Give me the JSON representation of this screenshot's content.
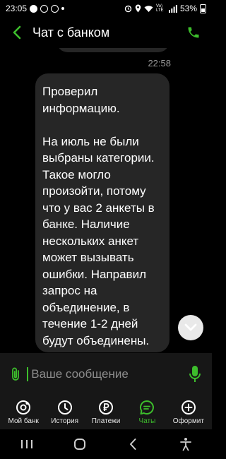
{
  "colors": {
    "accent": "#3dbe2c",
    "bubble": "#262626",
    "panel": "#171717",
    "background": "#000000"
  },
  "status_bar": {
    "time": "23:05",
    "network": "Vo) LTE",
    "battery": "53%"
  },
  "header": {
    "title": "Чат с банком",
    "back_icon": "chevron-left-icon",
    "call_icon": "phone-icon"
  },
  "messages": [
    {
      "time": "22:58",
      "paragraphs": [
        "Проверил информацию.",
        "На июль не были выбраны категории. Такое могло произойти, потому что у вас 2 анкеты в банке. Наличие нескольких анкет может вызывать ошибки. Направил запрос на объединение, в течение 1-2 дней будут объединены."
      ]
    }
  ],
  "composer": {
    "placeholder": "Ваше сообщение"
  },
  "nav": [
    {
      "label": "Мой банк",
      "icon": "my-bank-icon"
    },
    {
      "label": "История",
      "icon": "clock-icon"
    },
    {
      "label": "Платежи",
      "icon": "ruble-icon"
    },
    {
      "label": "Чаты",
      "icon": "chat-icon",
      "active": true
    },
    {
      "label": "Оформит",
      "icon": "plus-circle-icon"
    }
  ]
}
